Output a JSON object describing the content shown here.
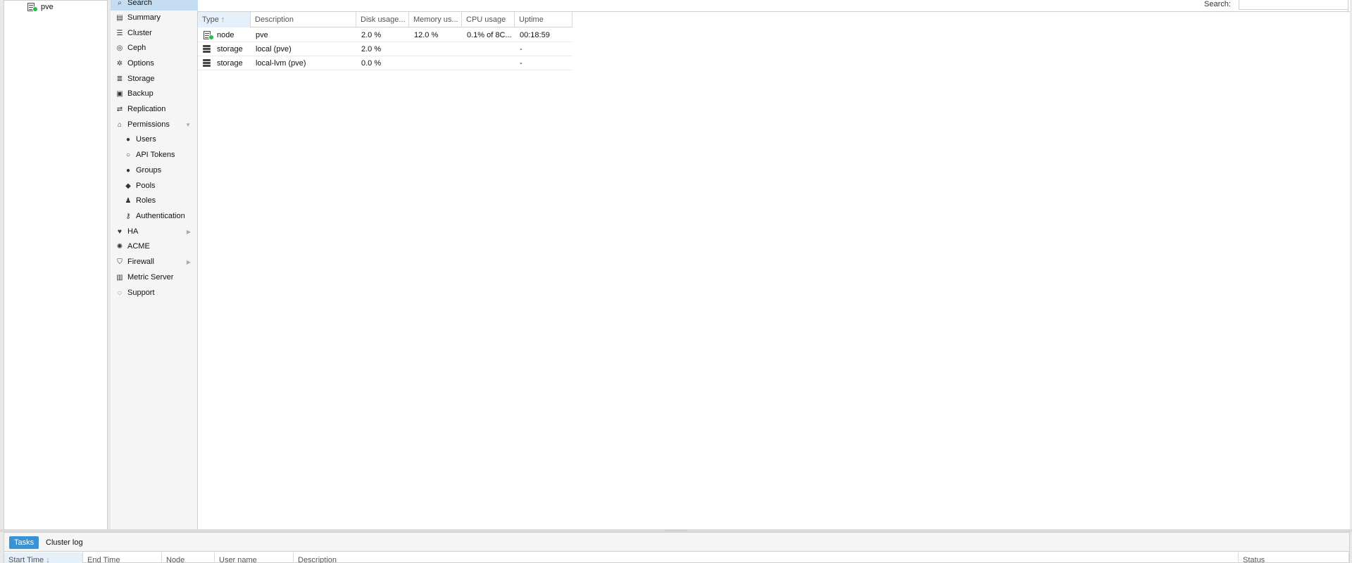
{
  "tree": {
    "node_label": "pve"
  },
  "nav": {
    "items": [
      {
        "label": "Search",
        "icon": "search-icon",
        "glyph": "⌕"
      },
      {
        "label": "Summary",
        "icon": "book-icon",
        "glyph": "▤"
      },
      {
        "label": "Cluster",
        "icon": "server-icon",
        "glyph": "☰"
      },
      {
        "label": "Ceph",
        "icon": "ceph-icon",
        "glyph": "◎"
      },
      {
        "label": "Options",
        "icon": "gear-icon",
        "glyph": "✲"
      },
      {
        "label": "Storage",
        "icon": "database-icon",
        "glyph": "≣"
      },
      {
        "label": "Backup",
        "icon": "floppy-icon",
        "glyph": "▣"
      },
      {
        "label": "Replication",
        "icon": "retweet-icon",
        "glyph": "⇄"
      },
      {
        "label": "Permissions",
        "icon": "unlock-icon",
        "glyph": "🔓"
      },
      {
        "label": "Users",
        "icon": "user-icon",
        "glyph": "●"
      },
      {
        "label": "API Tokens",
        "icon": "user-outline-icon",
        "glyph": "○"
      },
      {
        "label": "Groups",
        "icon": "users-icon",
        "glyph": "●●"
      },
      {
        "label": "Pools",
        "icon": "tags-icon",
        "glyph": "◆"
      },
      {
        "label": "Roles",
        "icon": "male-icon",
        "glyph": "♟"
      },
      {
        "label": "Authentication",
        "icon": "key-icon",
        "glyph": "⚷"
      },
      {
        "label": "HA",
        "icon": "heartbeat-icon",
        "glyph": "♥"
      },
      {
        "label": "ACME",
        "icon": "certificate-icon",
        "glyph": "✺"
      },
      {
        "label": "Firewall",
        "icon": "shield-icon",
        "glyph": "⛉"
      },
      {
        "label": "Metric Server",
        "icon": "bar-chart-icon",
        "glyph": "▥"
      },
      {
        "label": "Support",
        "icon": "comments-icon",
        "glyph": "◌"
      }
    ]
  },
  "search": {
    "label": "Search:",
    "value": ""
  },
  "grid": {
    "columns": [
      "Type",
      "Description",
      "Disk usage...",
      "Memory us...",
      "CPU usage",
      "Uptime"
    ],
    "rows": [
      {
        "type": "node",
        "type_icon": "node-icon",
        "description": "pve",
        "disk": "2.0 %",
        "memory": "12.0 %",
        "cpu": "0.1% of 8C...",
        "uptime": "00:18:59"
      },
      {
        "type": "storage",
        "type_icon": "storage-icon",
        "description": "local (pve)",
        "disk": "2.0 %",
        "memory": "",
        "cpu": "",
        "uptime": "-"
      },
      {
        "type": "storage",
        "type_icon": "storage-icon",
        "description": "local-lvm (pve)",
        "disk": "0.0 %",
        "memory": "",
        "cpu": "",
        "uptime": "-"
      }
    ]
  },
  "log": {
    "tabs": [
      "Tasks",
      "Cluster log"
    ],
    "columns": [
      "Start Time",
      "End Time",
      "Node",
      "User name",
      "Description",
      "Status"
    ]
  },
  "colors": {
    "accent": "#3892d4",
    "selected_nav": "#c4ddf3",
    "status_ok": "#21bf4b"
  }
}
